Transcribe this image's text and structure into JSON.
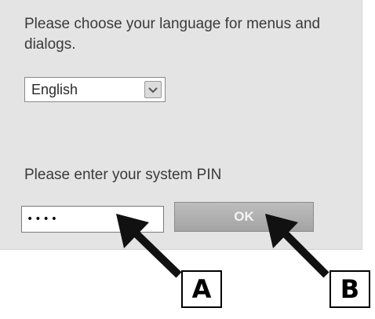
{
  "dialog": {
    "language_prompt": "Please choose your language for menus and dialogs.",
    "language_select": {
      "selected": "English"
    },
    "pin_prompt": "Please enter your system PIN",
    "pin_input": {
      "value": "••••"
    },
    "ok_button_label": "OK"
  },
  "annotations": {
    "callout_a": "A",
    "callout_b": "B"
  },
  "icons": {
    "dropdown": "chevron-down-icon"
  }
}
